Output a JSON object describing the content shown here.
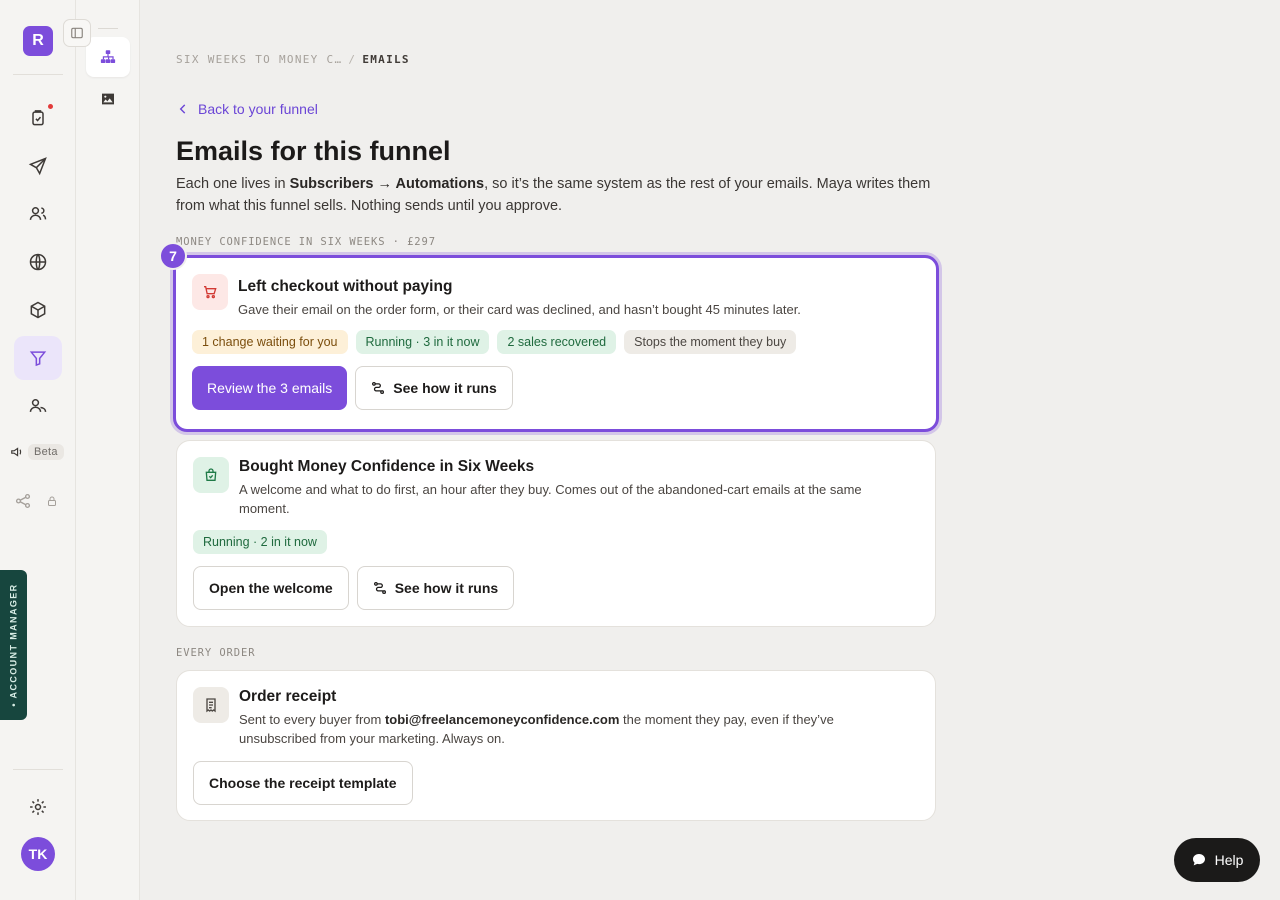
{
  "rail": {
    "logo_letter": "R",
    "beta_label": "Beta",
    "account_manager_label": "• ACCOUNT MANAGER",
    "avatar_initials": "TK"
  },
  "breadcrumb": {
    "parent": "SIX WEEKS TO MONEY C…",
    "separator": "/",
    "current": "EMAILS"
  },
  "back_link": "Back to your funnel",
  "page_title": "Emails for this funnel",
  "intro": {
    "before": "Each one lives in ",
    "location": "Subscribers → Automations",
    "after": ", so it’s the same system as the rest of your emails. Maya writes them from what this funnel sells. Nothing sends until you approve."
  },
  "sections": {
    "product_label": "MONEY CONFIDENCE IN SIX WEEKS · £297",
    "every_order_label": "EVERY ORDER"
  },
  "cards": {
    "abandoned": {
      "count": "7",
      "title": "Left checkout without paying",
      "description": "Gave their email on the order form, or their card was declined, and hasn’t bought 45 minutes later.",
      "badges": [
        "1 change waiting for you",
        "Running · 3 in it now",
        "2 sales recovered",
        "Stops the moment they buy"
      ],
      "primary_action": "Review the 3 emails",
      "secondary_action": "See how it runs"
    },
    "bought": {
      "title": "Bought Money Confidence in Six Weeks",
      "description": "A welcome and what to do first, an hour after they buy. Comes out of the abandoned-cart emails at the same moment.",
      "badges": [
        "Running · 2 in it now"
      ],
      "primary_action": "Open the welcome",
      "secondary_action": "See how it runs"
    },
    "receipt": {
      "title": "Order receipt",
      "desc_before": "Sent to every buyer from ",
      "email": "tobi@freelancemoneyconfidence.com",
      "desc_after": " the moment they pay, even if they’ve unsubscribed from your marketing. Always on.",
      "action": "Choose the receipt template"
    }
  },
  "help_label": "Help",
  "colors": {
    "accent": "#7c4ddb",
    "background": "#f0efed",
    "amber_badge": "#fdf0d8",
    "green_badge": "#dff2e6"
  }
}
